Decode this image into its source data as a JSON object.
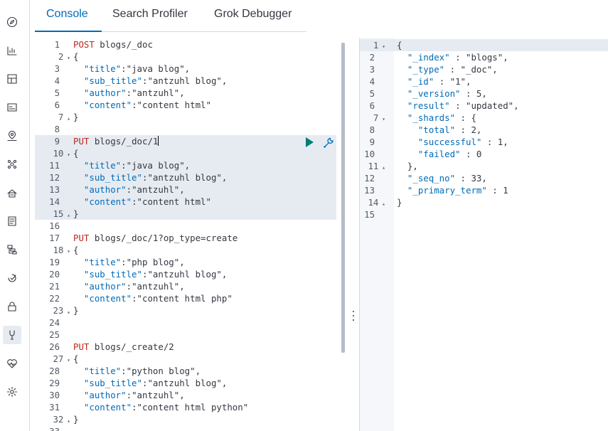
{
  "nav": {
    "icons": [
      "compass-icon",
      "dashboard-icon",
      "canvas-icon",
      "maps-icon",
      "ml-icon",
      "graph-icon",
      "uptime-icon",
      "logs-icon",
      "apm-icon",
      "siem-icon",
      "security-icon",
      "dev-tools-icon",
      "monitoring-icon",
      "management-icon"
    ],
    "active": "dev-tools-icon"
  },
  "tabs": [
    {
      "label": "Console",
      "active": true
    },
    {
      "label": "Search Profiler",
      "active": false
    },
    {
      "label": "Grok Debugger",
      "active": false
    }
  ],
  "editor": {
    "lines": [
      {
        "n": "1",
        "fold": "",
        "text": "POST blogs/_doc"
      },
      {
        "n": "2",
        "fold": "▾",
        "text": "{"
      },
      {
        "n": "3",
        "fold": "",
        "text": "  \"title\":\"java blog\","
      },
      {
        "n": "4",
        "fold": "",
        "text": "  \"sub_title\":\"antzuhl blog\","
      },
      {
        "n": "5",
        "fold": "",
        "text": "  \"author\":\"antzuhl\","
      },
      {
        "n": "6",
        "fold": "",
        "text": "  \"content\":\"content html\""
      },
      {
        "n": "7",
        "fold": "▴",
        "text": "}"
      },
      {
        "n": "8",
        "fold": "",
        "text": ""
      },
      {
        "n": "9",
        "fold": "",
        "text": "PUT blogs/_doc/1"
      },
      {
        "n": "10",
        "fold": "▾",
        "text": "{"
      },
      {
        "n": "11",
        "fold": "",
        "text": "  \"title\":\"java blog\","
      },
      {
        "n": "12",
        "fold": "",
        "text": "  \"sub_title\":\"antzuhl blog\","
      },
      {
        "n": "13",
        "fold": "",
        "text": "  \"author\":\"antzuhl\","
      },
      {
        "n": "14",
        "fold": "",
        "text": "  \"content\":\"content html\""
      },
      {
        "n": "15",
        "fold": "▴",
        "text": "}"
      },
      {
        "n": "16",
        "fold": "",
        "text": ""
      },
      {
        "n": "17",
        "fold": "",
        "text": "PUT blogs/_doc/1?op_type=create"
      },
      {
        "n": "18",
        "fold": "▾",
        "text": "{"
      },
      {
        "n": "19",
        "fold": "",
        "text": "  \"title\":\"php blog\","
      },
      {
        "n": "20",
        "fold": "",
        "text": "  \"sub_title\":\"antzuhl blog\","
      },
      {
        "n": "21",
        "fold": "",
        "text": "  \"author\":\"antzuhl\","
      },
      {
        "n": "22",
        "fold": "",
        "text": "  \"content\":\"content html php\""
      },
      {
        "n": "23",
        "fold": "▴",
        "text": "}"
      },
      {
        "n": "24",
        "fold": "",
        "text": ""
      },
      {
        "n": "25",
        "fold": "",
        "text": ""
      },
      {
        "n": "26",
        "fold": "",
        "text": "PUT blogs/_create/2"
      },
      {
        "n": "27",
        "fold": "▾",
        "text": "{"
      },
      {
        "n": "28",
        "fold": "",
        "text": "  \"title\":\"python blog\","
      },
      {
        "n": "29",
        "fold": "",
        "text": "  \"sub_title\":\"antzuhl blog\","
      },
      {
        "n": "30",
        "fold": "",
        "text": "  \"author\":\"antzuhl\","
      },
      {
        "n": "31",
        "fold": "",
        "text": "  \"content\":\"content html python\""
      },
      {
        "n": "32",
        "fold": "▴",
        "text": "}"
      },
      {
        "n": "33",
        "fold": "",
        "text": ""
      }
    ]
  },
  "output": {
    "lines": [
      {
        "n": "1",
        "fold": "▾",
        "text": "{"
      },
      {
        "n": "2",
        "fold": "",
        "text": "  \"_index\" : \"blogs\","
      },
      {
        "n": "3",
        "fold": "",
        "text": "  \"_type\" : \"_doc\","
      },
      {
        "n": "4",
        "fold": "",
        "text": "  \"_id\" : \"1\","
      },
      {
        "n": "5",
        "fold": "",
        "text": "  \"_version\" : 5,"
      },
      {
        "n": "6",
        "fold": "",
        "text": "  \"result\" : \"updated\","
      },
      {
        "n": "7",
        "fold": "▾",
        "text": "  \"_shards\" : {"
      },
      {
        "n": "8",
        "fold": "",
        "text": "    \"total\" : 2,"
      },
      {
        "n": "9",
        "fold": "",
        "text": "    \"successful\" : 1,"
      },
      {
        "n": "10",
        "fold": "",
        "text": "    \"failed\" : 0"
      },
      {
        "n": "11",
        "fold": "▴",
        "text": "  },"
      },
      {
        "n": "12",
        "fold": "",
        "text": "  \"_seq_no\" : 33,"
      },
      {
        "n": "13",
        "fold": "",
        "text": "  \"_primary_term\" : 1"
      },
      {
        "n": "14",
        "fold": "▴",
        "text": "}"
      },
      {
        "n": "15",
        "fold": "",
        "text": ""
      }
    ]
  },
  "colors": {
    "accent": "#006bb8",
    "method": "#bd271e",
    "play": "#017d73",
    "highlight": "#e6ebf2"
  }
}
